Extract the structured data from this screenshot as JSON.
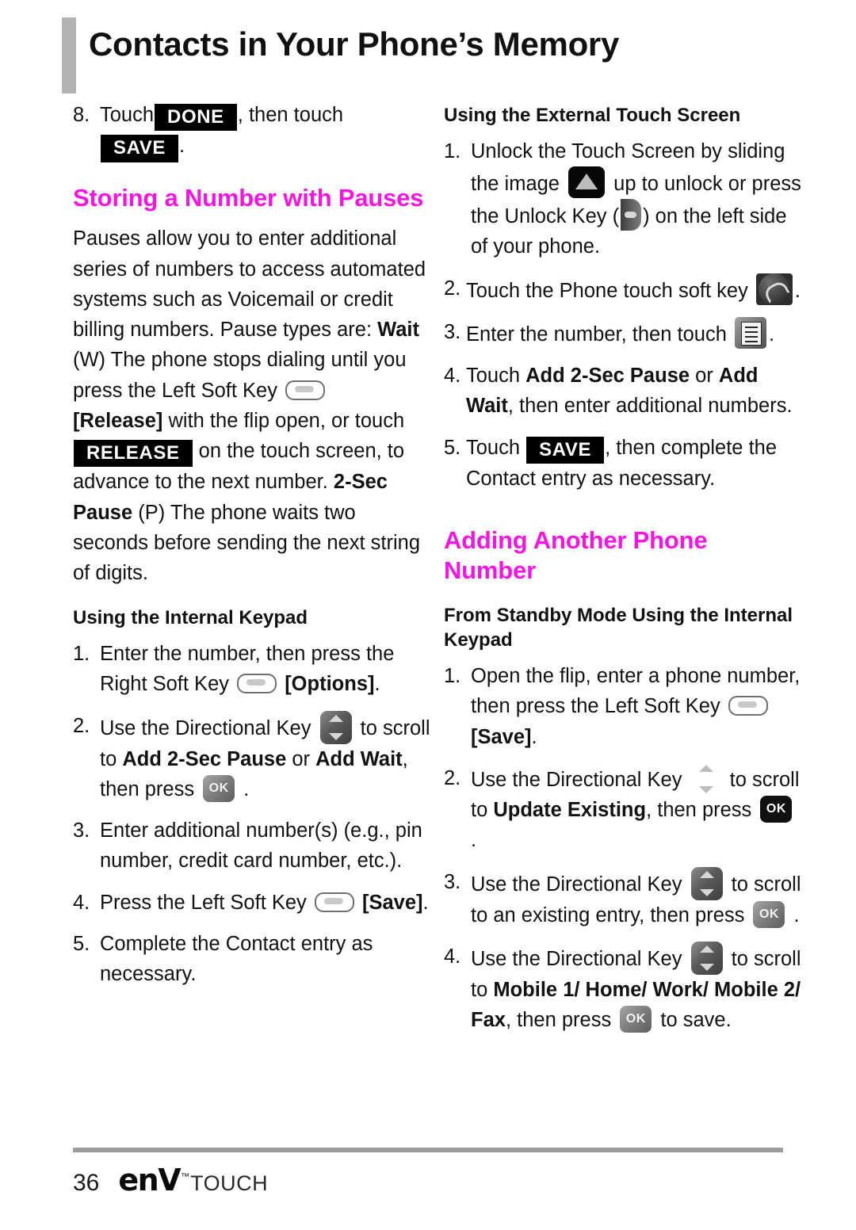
{
  "colors": {
    "heading_magenta": "#f514e4",
    "title_bar_gray": "#b3b3b3",
    "badge_black": "#000000",
    "footer_rule_gray": "#9c9c9c"
  },
  "header": {
    "title": "Contacts in Your Phone’s Memory"
  },
  "left_column": {
    "step8": {
      "num": "8.",
      "text_before": "Touch",
      "badge_done": "DONE",
      "text_middle": ", then touch",
      "badge_save": "SAVE",
      "text_after": "."
    },
    "heading_storing": "Storing a Number with Pauses",
    "paragraph": {
      "part1": "Pauses allow you to enter additional series of numbers to access automated systems such as Voicemail or credit billing numbers. Pause types are: ",
      "bold1": "Wait",
      "part2": " (W) The phone stops dialing until you press the Left Soft Key ",
      "icon1": "soft-key-icon",
      "bold2": "[Release]",
      "part3": " with the flip open, or touch ",
      "badge_release": "RELEASE",
      "part4": " on the touch screen, to advance to the next number. ",
      "bold3": "2-Sec Pause",
      "part5": " (P) The phone waits two seconds before sending the next string of digits."
    },
    "heading_internal_keypad": "Using the Internal Keypad",
    "steps": [
      {
        "num": "1.",
        "part1": "Enter the number, then press the Right Soft Key ",
        "icon": "soft-key-icon",
        "part2": " ",
        "bold": "[Options]",
        "part3": "."
      },
      {
        "num": "2.",
        "part1": "Use the Directional Key ",
        "icon": "directional-key-icon",
        "part2": " to scroll to ",
        "bold1": "Add 2-Sec Pause",
        "part3": " or ",
        "bold2": "Add Wait",
        "part4": ", then press ",
        "icon2": "ok-key-icon",
        "part5": " ."
      },
      {
        "num": "3.",
        "text": "Enter additional number(s) (e.g., pin number, credit card number, etc.)."
      },
      {
        "num": "4.",
        "part1": "Press the Left Soft Key ",
        "icon": "soft-key-icon",
        "part2": " ",
        "bold": "[Save]",
        "part3": "."
      },
      {
        "num": "5.",
        "text": "Complete the Contact entry as necessary."
      }
    ]
  },
  "right_column": {
    "heading_external_touch": "Using the External Touch Screen",
    "steps_external": [
      {
        "num": "1.",
        "part1": "Unlock the Touch Screen by sliding the image ",
        "icon1": "unlock-slider-icon",
        "part2": " up to unlock or press the Unlock Key (",
        "icon2": "side-unlock-key-icon",
        "part3": ") on the left side of your phone."
      },
      {
        "num": "2.",
        "part1": "Touch the Phone touch soft key ",
        "icon": "phone-touch-key-icon",
        "part2": "."
      },
      {
        "num": "3.",
        "part1": "Enter the number, then touch ",
        "icon": "list-key-icon",
        "part2": "."
      },
      {
        "num": "4.",
        "part1": "Touch ",
        "bold1": "Add 2-Sec Pause",
        "part2": " or ",
        "bold2": "Add Wait",
        "part3": ", then enter additional numbers."
      },
      {
        "num": "5.",
        "part1": "Touch ",
        "badge": "SAVE",
        "part2": ", then complete the Contact entry as necessary."
      }
    ],
    "heading_adding": "Adding Another Phone Number",
    "heading_standby": "From Standby Mode Using the Internal Keypad",
    "steps_standby": [
      {
        "num": "1.",
        "part1": "Open the flip, enter a phone number, then press the Left Soft Key ",
        "icon": "soft-key-icon",
        "part2": " ",
        "bold": "[Save]",
        "part3": "."
      },
      {
        "num": "2.",
        "part1": "Use the Directional Key ",
        "icon1": "directional-key-plain-icon",
        "part2": " to scroll to ",
        "bold": "Update Existing",
        "part3": ", then press ",
        "icon2": "ok-key-dark-icon",
        "part4": " ."
      },
      {
        "num": "3.",
        "part1": "Use the Directional Key ",
        "icon1": "directional-key-icon",
        "part2": " to scroll to an existing entry, then press ",
        "icon2": "ok-key-icon",
        "part3": " ."
      },
      {
        "num": "4.",
        "part1": "Use the Directional Key ",
        "icon1": "directional-key-icon",
        "part2": " to scroll to ",
        "bold": "Mobile 1/ Home/ Work/ Mobile 2/ Fax",
        "part3": ", then press ",
        "icon2": "ok-key-icon",
        "part4": " to save."
      }
    ]
  },
  "footer": {
    "page_number": "36",
    "logo_env": "enV",
    "logo_tm": "™",
    "logo_touch": "TOUCH"
  }
}
